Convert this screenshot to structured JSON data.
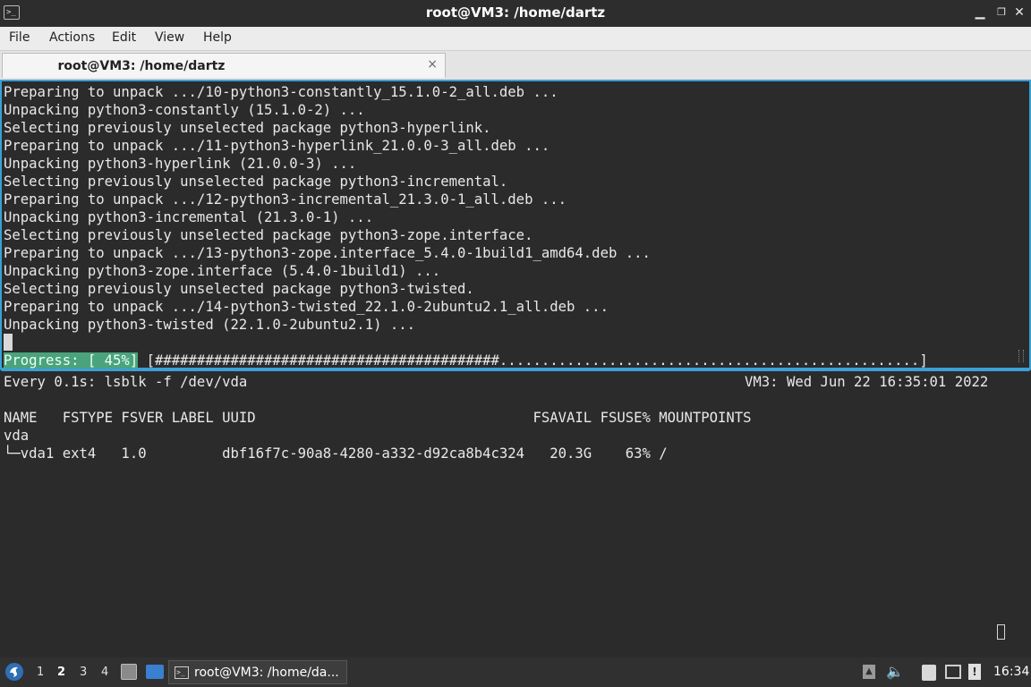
{
  "window": {
    "title": "root@VM3: /home/dartz",
    "icon": "terminal-icon",
    "controls": [
      "minimize-icon",
      "maximize-icon",
      "close-icon"
    ]
  },
  "menubar": {
    "items": [
      "File",
      "Actions",
      "Edit",
      "View",
      "Help"
    ]
  },
  "tab": {
    "label": "root@VM3: /home/dartz",
    "close": "×"
  },
  "terminal_top": {
    "lines": [
      "Preparing to unpack .../10-python3-constantly_15.1.0-2_all.deb ...",
      "Unpacking python3-constantly (15.1.0-2) ...",
      "Selecting previously unselected package python3-hyperlink.",
      "Preparing to unpack .../11-python3-hyperlink_21.0.0-3_all.deb ...",
      "Unpacking python3-hyperlink (21.0.0-3) ...",
      "Selecting previously unselected package python3-incremental.",
      "Preparing to unpack .../12-python3-incremental_21.3.0-1_all.deb ...",
      "Unpacking python3-incremental (21.3.0-1) ...",
      "Selecting previously unselected package python3-zope.interface.",
      "Preparing to unpack .../13-python3-zope.interface_5.4.0-1build1_amd64.deb ...",
      "Unpacking python3-zope.interface (5.4.0-1build1) ...",
      "Selecting previously unselected package python3-twisted.",
      "Preparing to unpack .../14-python3-twisted_22.1.0-2ubuntu2.1_all.deb ...",
      "Unpacking python3-twisted (22.1.0-2ubuntu2.1) ..."
    ],
    "progress_label": "Progress: [ 45%]",
    "progress_bar": " [#########################################..................................................]",
    "progress_value": 0.45
  },
  "terminal_bottom": {
    "watch_header": "Every 0.1s: lsblk -f /dev/vda",
    "watch_host_time": "VM3: Wed Jun 22 16:35:01 2022",
    "lines": [
      "NAME   FSTYPE FSVER LABEL UUID                                 FSAVAIL FSUSE% MOUNTPOINTS",
      "vda",
      "└─vda1 ext4   1.0         dbf16f7c-90a8-4280-a332-d92ca8b4c324   20.3G    63% /"
    ]
  },
  "taskbar": {
    "start_icon": "start-menu-icon",
    "workspaces": [
      "1",
      "2",
      "3",
      "4"
    ],
    "active_workspace": "2",
    "task_label": "root@VM3: /home/da...",
    "clock": "16:34",
    "tray_icons": [
      "up-arrow-icon",
      "volume-icon",
      "clipboard-icon",
      "network-icon",
      "notification-icon"
    ]
  }
}
